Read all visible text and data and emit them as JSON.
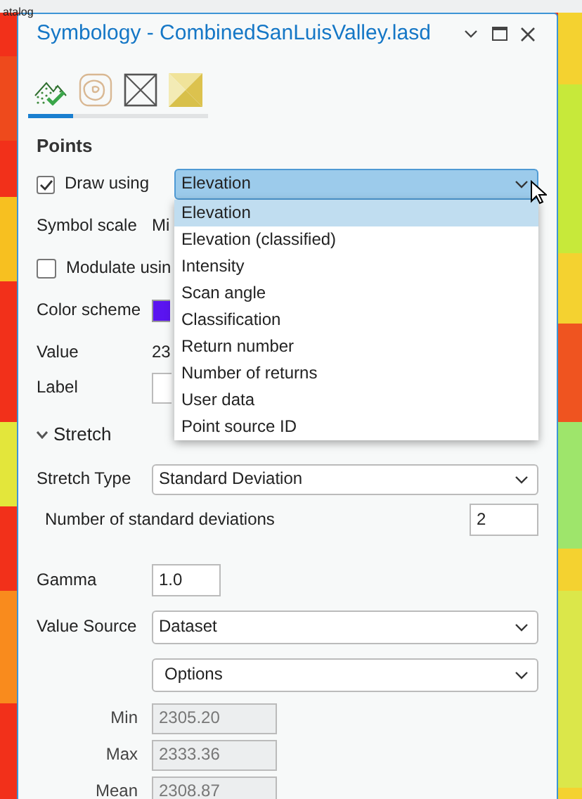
{
  "background_bar": {
    "label": "atalog"
  },
  "window": {
    "title": "Symbology - CombinedSanLuisValley.lasd"
  },
  "tabs": [
    {
      "kind": "points",
      "selected": true
    },
    {
      "kind": "contours",
      "selected": false
    },
    {
      "kind": "edges",
      "selected": false
    },
    {
      "kind": "surface",
      "selected": false
    }
  ],
  "section": "Points",
  "draw_using": {
    "label": "Draw using",
    "checked": true,
    "value": "Elevation",
    "expanded": true,
    "options": [
      {
        "label": "Elevation",
        "selected": true
      },
      {
        "label": "Elevation (classified)",
        "selected": false
      },
      {
        "label": "Intensity",
        "selected": false
      },
      {
        "label": "Scan angle",
        "selected": false
      },
      {
        "label": "Classification",
        "selected": false
      },
      {
        "label": "Return number",
        "selected": false
      },
      {
        "label": "Number of returns",
        "selected": false
      },
      {
        "label": "User data",
        "selected": false
      },
      {
        "label": "Point source ID",
        "selected": false
      }
    ]
  },
  "symbol_scale": {
    "label": "Symbol scale",
    "value": "Mi"
  },
  "modulate": {
    "label": "Modulate usin",
    "checked": false
  },
  "color_scheme": {
    "label": "Color scheme",
    "color": "#5a14f0"
  },
  "value": {
    "label": "Value",
    "value": "23"
  },
  "label_field": {
    "label": "Label"
  },
  "stretch": {
    "title": "Stretch",
    "expanded": true,
    "stretch_type": {
      "label": "Stretch Type",
      "value": "Standard Deviation"
    },
    "std_devs": {
      "label": "Number of standard deviations",
      "value": "2"
    },
    "gamma": {
      "label": "Gamma",
      "value": "1.0"
    },
    "value_source": {
      "label": "Value Source",
      "value": "Dataset"
    },
    "options": {
      "value": "Options"
    },
    "stats": [
      {
        "label": "Min",
        "value": "2305.20"
      },
      {
        "label": "Max",
        "value": "2333.36"
      },
      {
        "label": "Mean",
        "value": "2308.87"
      }
    ]
  }
}
